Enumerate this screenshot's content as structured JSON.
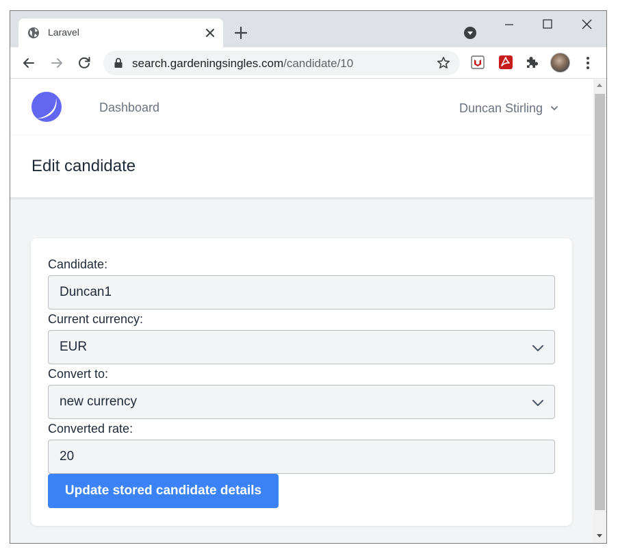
{
  "browser": {
    "tab_title": "Laravel",
    "url_host": "search.gardeningsingles.com",
    "url_path": "/candidate/10"
  },
  "navbar": {
    "dashboard_link": "Dashboard",
    "user_name": "Duncan Stirling",
    "logo_color": "#6366f1"
  },
  "header": {
    "title": "Edit candidate"
  },
  "form": {
    "candidate_label": "Candidate:",
    "candidate_value": "Duncan1",
    "current_currency_label": "Current currency:",
    "current_currency_value": "EUR",
    "convert_to_label": "Convert to:",
    "convert_to_value": "new currency",
    "converted_rate_label": "Converted rate:",
    "converted_rate_value": "20",
    "submit_label": "Update stored candidate details",
    "submit_color": "#3b82f6"
  }
}
